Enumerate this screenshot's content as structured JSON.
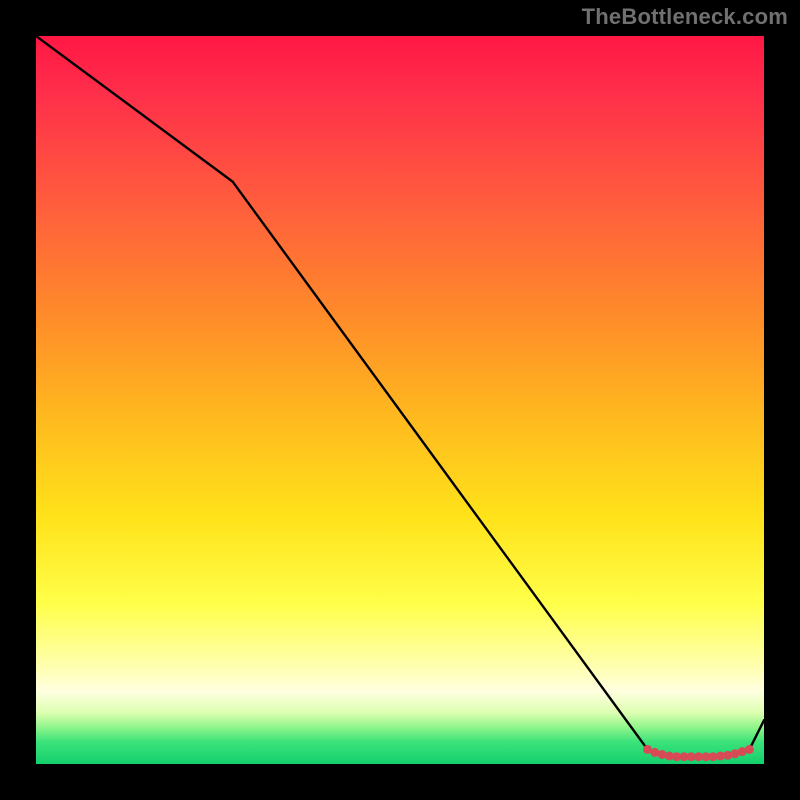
{
  "watermark": "TheBottleneck.com",
  "chart_data": {
    "type": "line",
    "title": "",
    "xlabel": "",
    "ylabel": "",
    "xlim": [
      0,
      100
    ],
    "ylim": [
      0,
      100
    ],
    "series": [
      {
        "name": "curve",
        "x": [
          0,
          27,
          84,
          87,
          93,
          98,
          100
        ],
        "y": [
          100,
          80,
          2,
          1,
          1,
          2,
          6
        ]
      }
    ],
    "markers": {
      "name": "highlight-band",
      "x": [
        84,
        85,
        86,
        87,
        88,
        89,
        90,
        91,
        92,
        93,
        94,
        95,
        96,
        97,
        98
      ],
      "y": [
        2,
        1.6,
        1.3,
        1.1,
        1,
        1,
        1,
        1,
        1,
        1,
        1.1,
        1.2,
        1.4,
        1.7,
        2
      ]
    },
    "gradient_stops": [
      {
        "pos": 0.0,
        "color": "#ff1744"
      },
      {
        "pos": 0.38,
        "color": "#ff8a2a"
      },
      {
        "pos": 0.66,
        "color": "#ffe21a"
      },
      {
        "pos": 0.9,
        "color": "#ffffe0"
      },
      {
        "pos": 1.0,
        "color": "#14d06c"
      }
    ]
  }
}
